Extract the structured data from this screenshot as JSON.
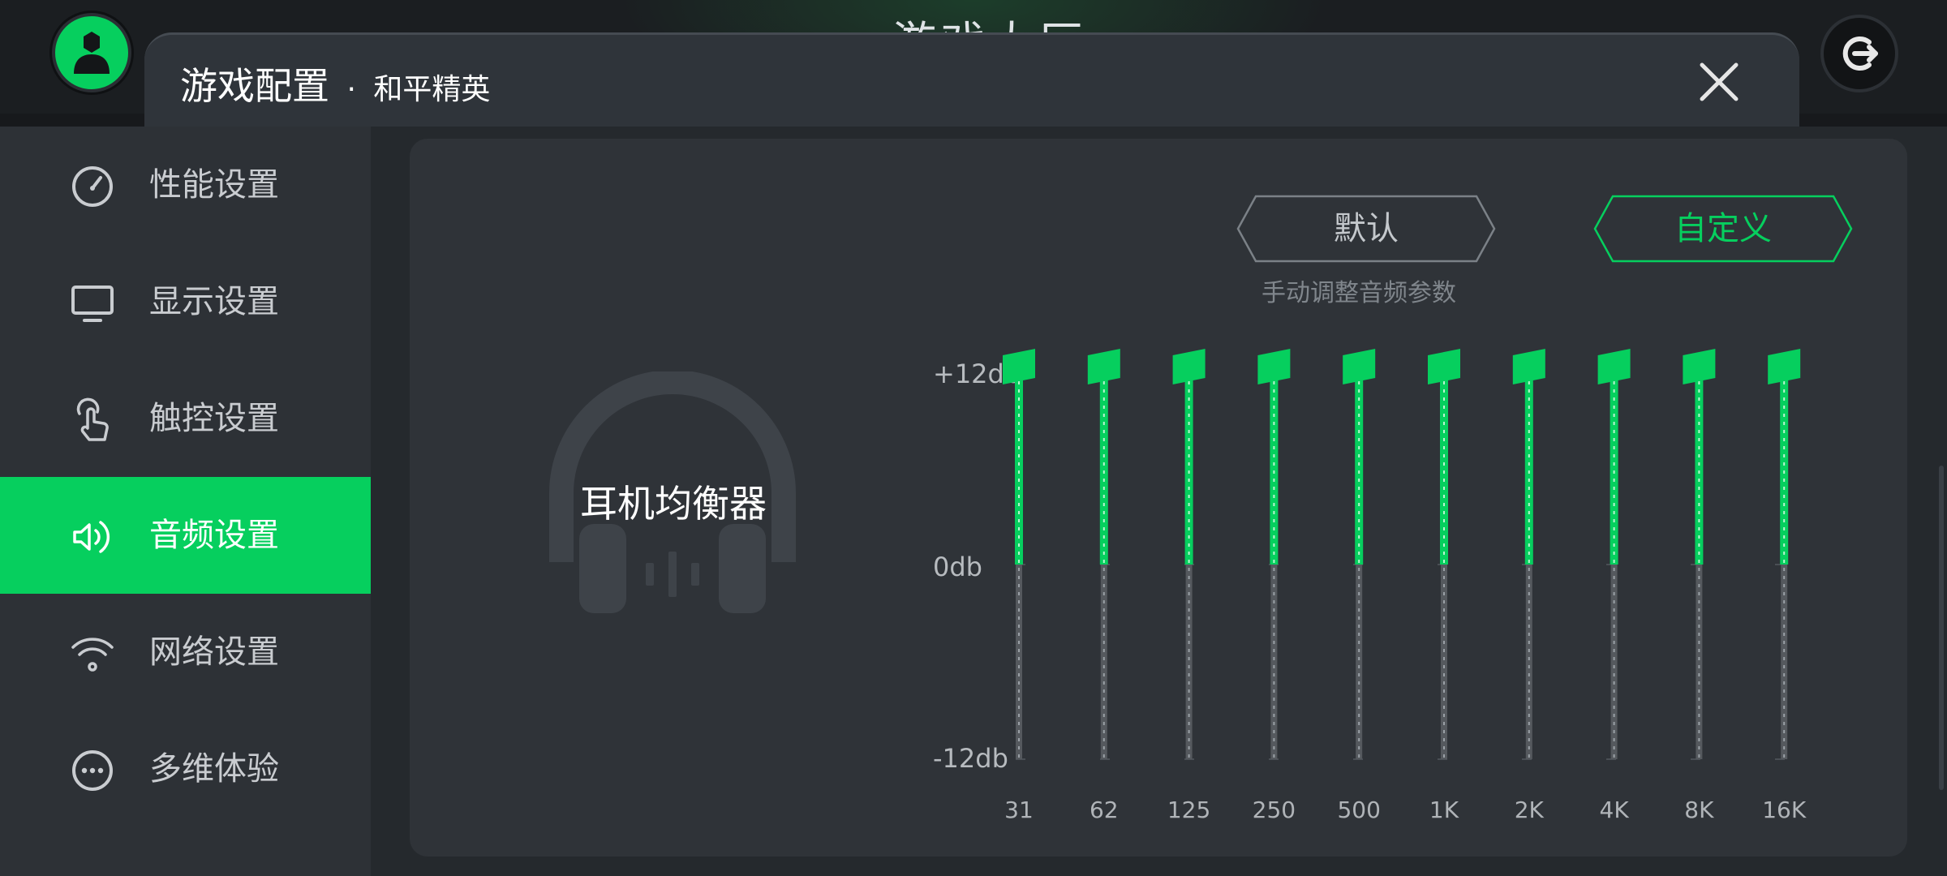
{
  "header": {
    "bg_title": "游戏大厅",
    "title": "游戏配置",
    "separator": " · ",
    "subtitle": "和平精英"
  },
  "sidebar": {
    "items": [
      {
        "label": "性能设置",
        "icon": "speedometer-icon",
        "active": false
      },
      {
        "label": "显示设置",
        "icon": "monitor-icon",
        "active": false
      },
      {
        "label": "触控设置",
        "icon": "touch-icon",
        "active": false
      },
      {
        "label": "音频设置",
        "icon": "speaker-icon",
        "active": true
      },
      {
        "label": "网络设置",
        "icon": "wifi-icon",
        "active": false
      },
      {
        "label": "多维体验",
        "icon": "more-icon",
        "active": false
      }
    ]
  },
  "equalizer": {
    "title": "耳机均衡器",
    "presets": {
      "default": "默认",
      "custom": "自定义",
      "selected": "custom"
    },
    "hint": "手动调整音频参数",
    "db_labels": {
      "max": "+12db",
      "zero": "0db",
      "min": "-12db"
    },
    "range_db": [
      -12,
      12
    ],
    "bands": [
      {
        "freq": "31",
        "gain_db": 12
      },
      {
        "freq": "62",
        "gain_db": 12
      },
      {
        "freq": "125",
        "gain_db": 12
      },
      {
        "freq": "250",
        "gain_db": 12
      },
      {
        "freq": "500",
        "gain_db": 12
      },
      {
        "freq": "1K",
        "gain_db": 12
      },
      {
        "freq": "2K",
        "gain_db": 12
      },
      {
        "freq": "4K",
        "gain_db": 12
      },
      {
        "freq": "8K",
        "gain_db": 12
      },
      {
        "freq": "16K",
        "gain_db": 12
      }
    ]
  },
  "colors": {
    "accent": "#06cf5e",
    "panel": "#2f3338",
    "sidebar": "#2d3136",
    "track": "#55595e"
  }
}
